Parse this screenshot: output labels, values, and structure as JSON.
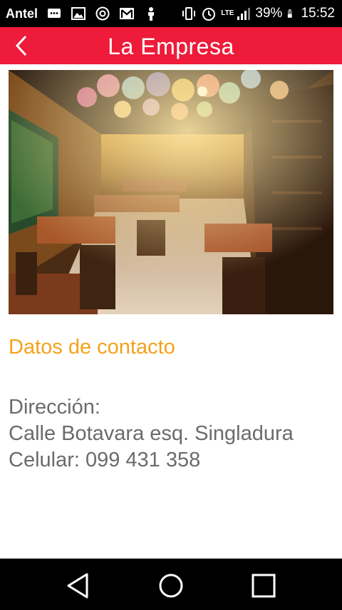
{
  "status_bar": {
    "carrier": "Antel",
    "icons": [
      "message-icon",
      "image-icon",
      "target-icon",
      "gmail-icon",
      "person-icon",
      "vibrate-icon",
      "alarm-icon"
    ],
    "network": "LTE",
    "battery": "39%",
    "time": "15:52"
  },
  "app_bar": {
    "title": "La Empresa",
    "color": "#ee1b3a",
    "back_icon": "chevron-left-icon"
  },
  "photo": {
    "subject": "restaurant-interior"
  },
  "contact": {
    "section_title": "Datos de contacto",
    "address_label": "Dirección:",
    "address": "Calle Botavara esq. Singladura",
    "phone": "Celular: 099 431 358",
    "accent_color": "#f3a21a"
  },
  "nav_bar": {
    "buttons": [
      "back-triangle-icon",
      "home-circle-icon",
      "recents-square-icon"
    ]
  }
}
